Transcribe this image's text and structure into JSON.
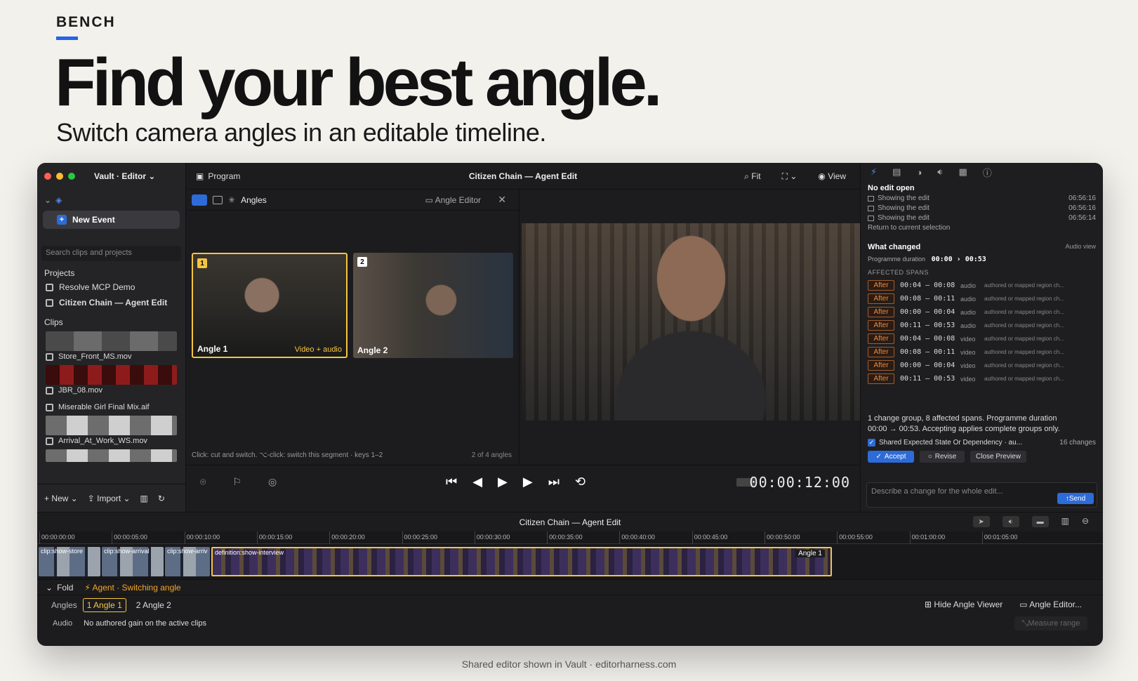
{
  "hero": {
    "brand": "BENCH",
    "headline": "Find your best angle.",
    "subhead": "Switch camera angles in an editable timeline.",
    "footer": "Shared editor shown in Vault · editorharness.com"
  },
  "colors": {
    "accent": "#2563eb",
    "angle_highlight": "#f5c542",
    "after_orange": "#f08a3a"
  },
  "sidebar": {
    "title": "Vault · Editor ⌄",
    "new_event": "New Event",
    "search_placeholder": "Search clips and projects",
    "projects_label": "Projects",
    "projects": [
      "Resolve MCP Demo",
      "Citizen Chain — Agent Edit"
    ],
    "clips_label": "Clips",
    "clips": [
      "Store_Front_MS.mov",
      "JBR_08.mov",
      "Miserable Girl Final Mix.aif",
      "Arrival_At_Work_WS.mov"
    ],
    "new_label": "New ⌄",
    "import_label": "Import ⌄"
  },
  "program": {
    "tab": "Program",
    "title": "Citizen Chain — Agent Edit",
    "fit": "Fit",
    "view": "View",
    "angles_title": "Angles",
    "angle_editor": "Angle Editor",
    "angle1_label": "Angle 1",
    "angle1_num": "1",
    "angle1_tag": "Video + audio",
    "angle2_label": "Angle 2",
    "angle2_num": "2",
    "hint": "Click: cut and switch. ⌥-click: switch this segment · keys 1–2",
    "count": "2 of 4 angles",
    "timecode": "00:00:12:00"
  },
  "inspector": {
    "no_edit": "No edit open",
    "history": [
      {
        "label": "Showing the edit",
        "time": "06:56:16"
      },
      {
        "label": "Showing the edit",
        "time": "06:56:16"
      },
      {
        "label": "Showing the edit",
        "time": "06:56:14"
      }
    ],
    "return": "Return to current selection",
    "what_changed": "What changed",
    "audio_view": "Audio view",
    "prog_duration_label": "Programme duration",
    "prog_duration_value": "00:00 › 00:53",
    "affected_label": "AFFECTED SPANS",
    "spans": [
      {
        "tag": "After",
        "range": "00:04 – 00:08",
        "kind": "audio",
        "desc": "authored or mapped region ch..."
      },
      {
        "tag": "After",
        "range": "00:08 – 00:11",
        "kind": "audio",
        "desc": "authored or mapped region ch..."
      },
      {
        "tag": "After",
        "range": "00:00 – 00:04",
        "kind": "audio",
        "desc": "authored or mapped region ch..."
      },
      {
        "tag": "After",
        "range": "00:11 – 00:53",
        "kind": "audio",
        "desc": "authored or mapped region ch..."
      },
      {
        "tag": "After",
        "range": "00:04 – 00:08",
        "kind": "video",
        "desc": "authored or mapped region ch..."
      },
      {
        "tag": "After",
        "range": "00:08 – 00:11",
        "kind": "video",
        "desc": "authored or mapped region ch..."
      },
      {
        "tag": "After",
        "range": "00:00 – 00:04",
        "kind": "video",
        "desc": "authored or mapped region ch..."
      },
      {
        "tag": "After",
        "range": "00:11 – 00:53",
        "kind": "video",
        "desc": "authored or mapped region ch..."
      }
    ],
    "summary_1": "1 change group, 8 affected spans. Programme duration",
    "summary_2": "00:00 → 00:53. Accepting applies complete groups only.",
    "shared_label": "Shared Expected State Or Dependency · au...",
    "changes": "16 changes",
    "accept": "Accept",
    "revise": "Revise",
    "close_preview": "Close Preview",
    "describe_placeholder": "Describe a change for the whole edit...",
    "send": "Send"
  },
  "timeline": {
    "title": "Citizen Chain — Agent Edit",
    "ticks": [
      "00:00:00:00",
      "00:00:05:00",
      "00:00:10:00",
      "00:00:15:00",
      "00:00:20:00",
      "00:00:25:00",
      "00:00:30:00",
      "00:00:35:00",
      "00:00:40:00",
      "00:00:45:00",
      "00:00:50:00",
      "00:00:55:00",
      "00:01:00:00",
      "00:01:05:00"
    ],
    "clips": [
      "clip:show-store",
      "clip:show-arrival",
      "clip:show-arriv",
      "definition:show-interview"
    ],
    "main_angle": "Angle 1",
    "fold": "Fold",
    "agent": "Agent · Switching angle",
    "angles_label": "Angles",
    "angle_btn_1": "1 Angle 1",
    "angle_btn_2": "2 Angle 2",
    "hide_viewer": "Hide Angle Viewer",
    "angle_editor": "Angle Editor...",
    "audio_label": "Audio",
    "audio_text": "No authored gain on the active clips",
    "measure": "Measure range"
  }
}
